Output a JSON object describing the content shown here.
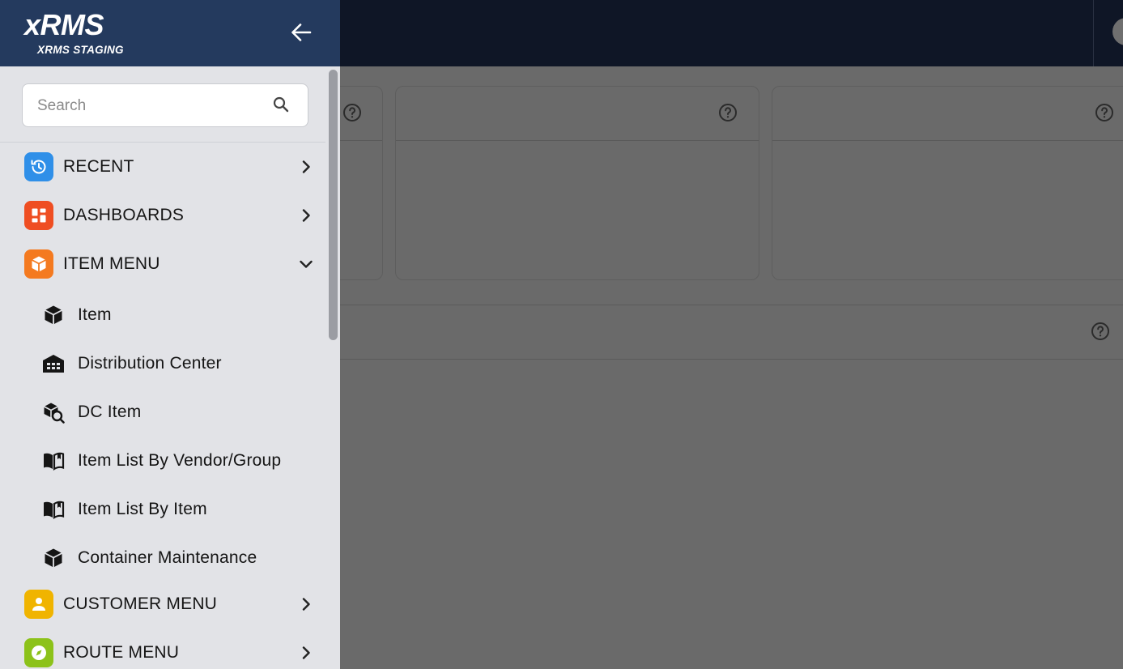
{
  "brand": {
    "title": "xRMS",
    "subtitle": "XRMS STAGING"
  },
  "search": {
    "placeholder": "Search",
    "value": ""
  },
  "menu": [
    {
      "label": "RECENT",
      "icon": "history-icon",
      "color": "#2f8fe8",
      "expanded": false
    },
    {
      "label": "DASHBOARDS",
      "icon": "dashboard-icon",
      "color": "#ef4e22",
      "expanded": false
    },
    {
      "label": "ITEM MENU",
      "icon": "cube-icon",
      "color": "#f47a20",
      "expanded": true
    },
    {
      "label": "CUSTOMER MENU",
      "icon": "person-icon",
      "color": "#f0b400",
      "expanded": false
    },
    {
      "label": "ROUTE MENU",
      "icon": "compass-icon",
      "color": "#8cc21a",
      "expanded": false
    }
  ],
  "item_menu_children": [
    {
      "label": "Item",
      "icon": "cube-icon"
    },
    {
      "label": "Distribution Center",
      "icon": "warehouse-icon"
    },
    {
      "label": "DC Item",
      "icon": "cube-search-icon"
    },
    {
      "label": "Item List By Vendor/Group",
      "icon": "book-icon"
    },
    {
      "label": "Item List By Item",
      "icon": "book-icon"
    },
    {
      "label": "Container Maintenance",
      "icon": "cube-icon"
    }
  ],
  "colors": {
    "header": "#243a5e",
    "topbar": "#0f1626",
    "drawer": "#e2e3e7",
    "overlay": "#6a6a6a"
  }
}
